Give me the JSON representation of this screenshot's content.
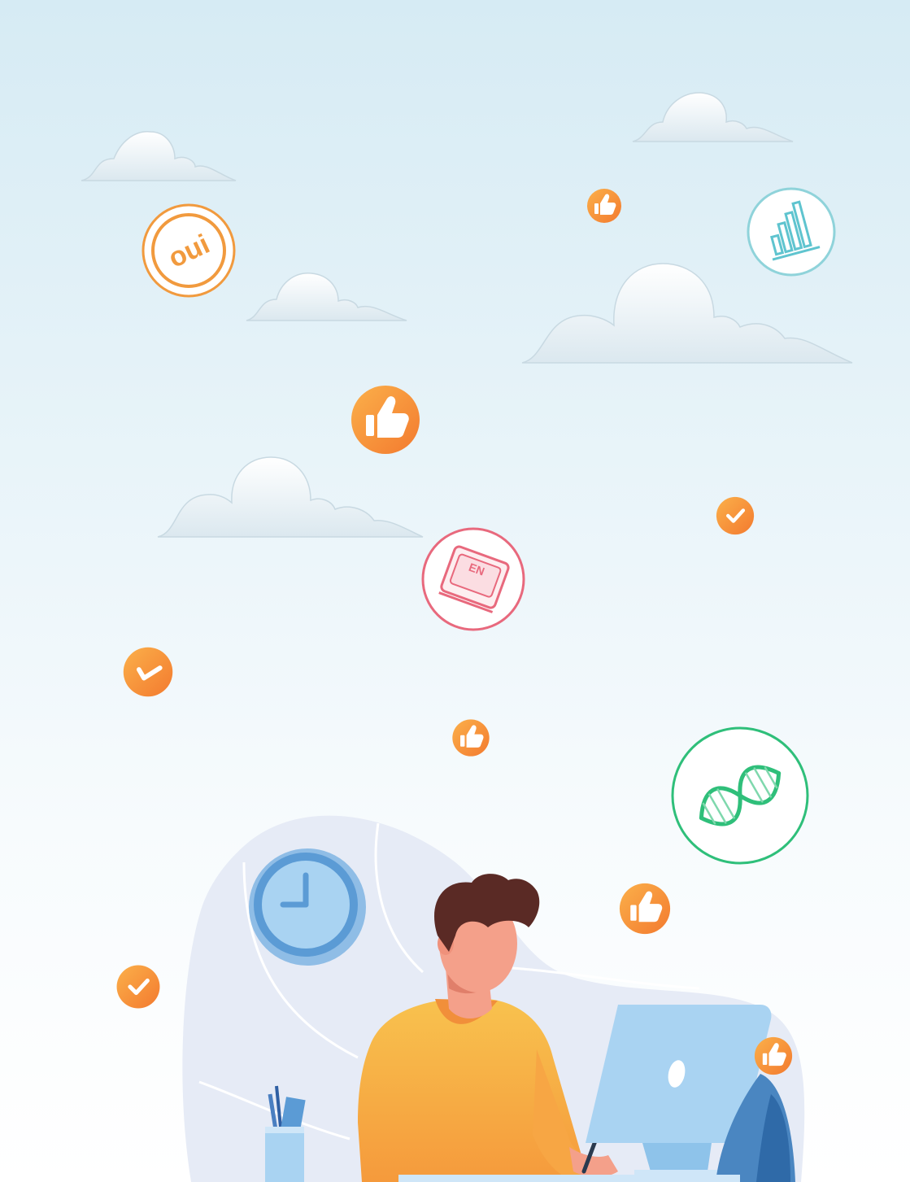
{
  "illustration": {
    "badge_oui": {
      "text": "oui",
      "icon": "oui-word-icon",
      "color": "#f19a3e"
    },
    "badge_en": {
      "text": "EN",
      "icon": "language-book-icon",
      "color": "#e8697d"
    },
    "badge_chart": {
      "icon": "bar-chart-icon",
      "color": "#5fc4cf"
    },
    "badge_dna": {
      "icon": "dna-helix-icon",
      "color": "#2fbf7a"
    },
    "thumbs_icon": "thumbs-up-icon",
    "check_icon": "checkmark-icon",
    "clock_icon": "wall-clock-icon",
    "colors": {
      "sky_top": "#d6ebf4",
      "sky_bottom": "#ffffff",
      "orange_badge": "#f7923a",
      "blob": "#e6ebf6",
      "monitor": "#a9d3f2",
      "shirt": "#f7b64a",
      "hair": "#5a2a25",
      "skin": "#f4a08a"
    }
  }
}
